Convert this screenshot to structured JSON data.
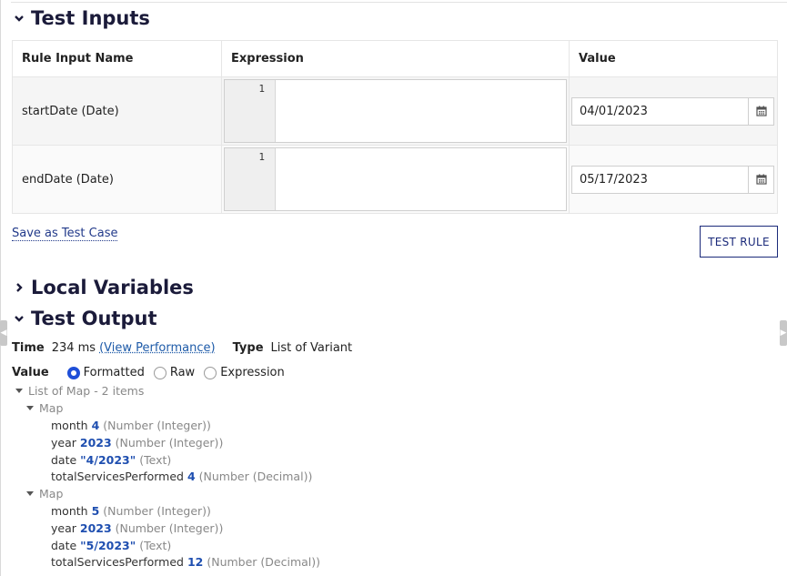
{
  "sections": {
    "test_inputs": "Test Inputs",
    "local_variables": "Local Variables",
    "test_output": "Test Output"
  },
  "inputs_table": {
    "headers": [
      "Rule Input Name",
      "Expression",
      "Value"
    ],
    "rows": [
      {
        "name": "startDate (Date)",
        "line": "1",
        "value": "04/01/2023"
      },
      {
        "name": "endDate (Date)",
        "line": "1",
        "value": "05/17/2023"
      }
    ]
  },
  "actions": {
    "save_test_case": "Save as Test Case",
    "test_rule": "TEST RULE"
  },
  "output": {
    "time_label": "Time",
    "time_value": "234 ms",
    "view_performance": "(View Performance)",
    "type_label": "Type",
    "type_value": "List of Variant",
    "value_label": "Value",
    "radio_options": [
      "Formatted",
      "Raw",
      "Expression"
    ],
    "selected_radio": "Formatted",
    "list_header": "List of Map - 2 items",
    "map_label": "Map",
    "maps": [
      {
        "entries": [
          {
            "key": "month",
            "value": "4",
            "type": "(Number (Integer))"
          },
          {
            "key": "year",
            "value": "2023",
            "type": "(Number (Integer))"
          },
          {
            "key": "date",
            "value": "\"4/2023\"",
            "type": "(Text)"
          },
          {
            "key": "totalServicesPerformed",
            "value": "4",
            "type": "(Number (Decimal))"
          }
        ]
      },
      {
        "entries": [
          {
            "key": "month",
            "value": "5",
            "type": "(Number (Integer))"
          },
          {
            "key": "year",
            "value": "2023",
            "type": "(Number (Integer))"
          },
          {
            "key": "date",
            "value": "\"5/2023\"",
            "type": "(Text)"
          },
          {
            "key": "totalServicesPerformed",
            "value": "12",
            "type": "(Number (Decimal))"
          }
        ]
      }
    ]
  },
  "colors": {
    "heading": "#1b1b3a",
    "link": "#1d5aa8",
    "value_blue": "#1f4fb0",
    "radio_on": "#1f4fd8"
  }
}
